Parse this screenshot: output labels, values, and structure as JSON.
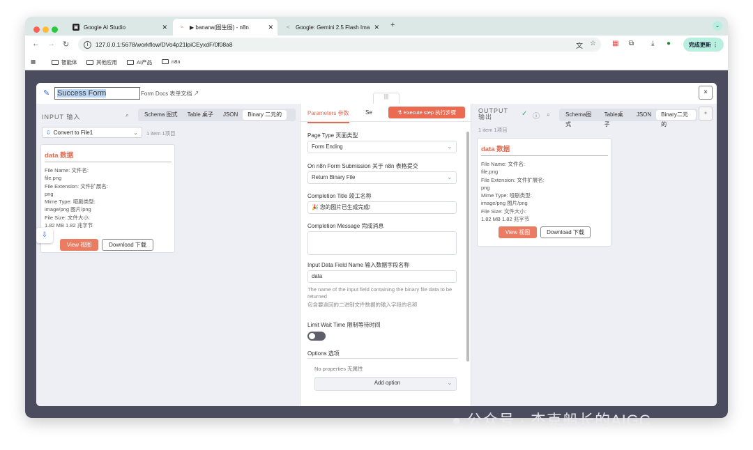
{
  "browser": {
    "tabs": [
      {
        "label": "Google AI Studio",
        "active": false
      },
      {
        "label": "▶ banana(图生图) - n8n",
        "active": true
      },
      {
        "label": "Google: Gemini 2.5 Flash Ima",
        "active": false
      }
    ],
    "new_tab": "+",
    "url": "127.0.0.1:5678/workflow/DVo4p21lpiCEyxdF/0f08a8",
    "update_label": "完成更新",
    "bookmarks": [
      "智能体",
      "其他应用",
      "AI产品",
      "n8n"
    ]
  },
  "modal": {
    "node_title": "Success Form",
    "docs_label": "Form Docs 表单文档",
    "close_label": "×",
    "grip_label": "|||",
    "input": {
      "title": "INPUT 输入",
      "view_tabs": [
        "Schema 图式",
        "Table 桌子",
        "JSON",
        "Binary 二元的"
      ],
      "active_view": "Binary 二元的",
      "source_node": "Convert to File1",
      "item_count": "1 item 1项目",
      "card": {
        "title": "data 数据",
        "lines": [
          "File Name: 文件名:",
          "file.png",
          "File Extension: 文件扩展名:",
          "png",
          "Mime Type: 哑剧类型:",
          "image/png 图片/png",
          "File Size: 文件大小:",
          "1.82 MB 1.82 兆字节"
        ],
        "view_label": "View 视图",
        "download_label": "Download 下载"
      }
    },
    "params": {
      "tabs": [
        "Parameters 参数",
        "Se"
      ],
      "active_tab": "Parameters 参数",
      "execute_label": "Execute step 执行步骤",
      "page_type_label": "Page Type 页面类型",
      "page_type_value": "Form Ending",
      "on_submit_label": "On n8n Form Submission 关于 n8n 表格提交",
      "on_submit_value": "Return Binary File",
      "completion_title_label": "Completion Title 竣工名称",
      "completion_title_value": "🎉 您的图片已生成完成!",
      "completion_message_label": "Completion Message 完成消息",
      "completion_message_value": "",
      "input_field_label": "Input Data Field Name 输入数据字段名称",
      "input_field_value": "data",
      "input_field_hint_en": "The name of the input field containing the binary file data to be returned",
      "input_field_hint_zh": "包含要返回的二进制文件数据的输入字段的名称",
      "limit_wait_label": "Limit Wait Time 限制等待时间",
      "limit_wait_enabled": false,
      "options_label": "Options 选项",
      "no_properties": "No properties 无属性",
      "add_option_label": "Add option"
    },
    "output": {
      "title_line1": "OUTPUT",
      "title_line2": "输出",
      "view_tabs": [
        "Schema图式",
        "Table桌子",
        "JSON",
        "Binary二元的"
      ],
      "active_view": "Binary二元的",
      "item_count": "1 item 1项目",
      "card": {
        "title": "data 数据",
        "lines": [
          "File Name: 文件名:",
          "file.png",
          "File Extension: 文件扩展名:",
          "png",
          "Mime Type: 哑剧类型:",
          "image/png 图片/png",
          "File Size: 文件大小:",
          "1.82 MB 1.82 兆字节"
        ],
        "view_label": "View 视图",
        "download_label": "Download 下载"
      }
    }
  },
  "watermark": "公众号 · 杰克船长的AIGC",
  "colors": {
    "accent": "#ea6a52",
    "background": "#4b4c5d",
    "panel": "#edeff4"
  }
}
